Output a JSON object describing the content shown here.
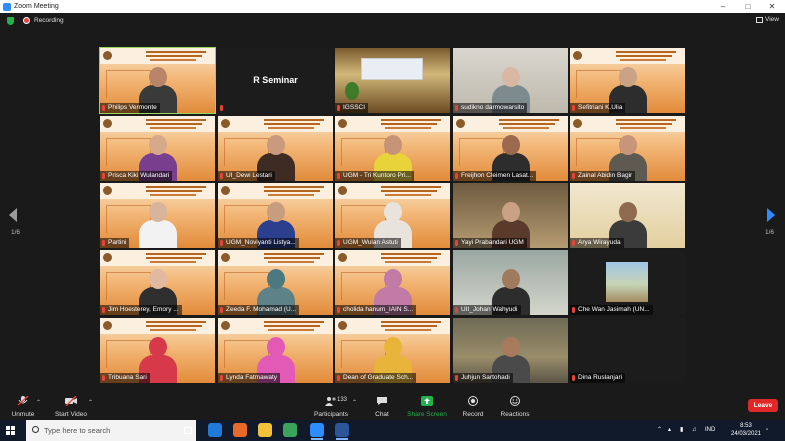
{
  "window": {
    "title": "Zoom Meeting"
  },
  "top": {
    "recording": "Recording",
    "view": "View"
  },
  "nav": {
    "left_page": "1/6",
    "right_page": "1/6"
  },
  "tiles": [
    {
      "name": "Philips Vermonte",
      "style": "banner",
      "speaking": true,
      "skin": "#b9856a",
      "shirt": "#3a3a3a"
    },
    {
      "name": "",
      "style": "black",
      "center_text": "R Seminar"
    },
    {
      "name": "IGSSCI",
      "style": "room"
    },
    {
      "name": "sudikno darmowarsito",
      "style": "home1",
      "skin": "#d8b8a2",
      "shirt": "#7d8a8e"
    },
    {
      "name": "Sefitriani K.Ulia",
      "style": "banner",
      "skin": "#caa285",
      "shirt": "#2d2d2d"
    },
    {
      "name": "Prisca Kiki Wulandari",
      "style": "banner",
      "skin": "#d6a98a",
      "shirt": "#7a3e8e"
    },
    {
      "name": "UI_Dewi Lestari",
      "style": "banner",
      "skin": "#c99a7d",
      "shirt": "#3d2b24"
    },
    {
      "name": "UGM - Tri Kuntoro Pri...",
      "style": "banner",
      "skin": "#c69376",
      "shirt": "#e9d33a"
    },
    {
      "name": "Freijhon Cleimen Lasat...",
      "style": "banner",
      "skin": "#9b6a4e",
      "shirt": "#2d2d2d"
    },
    {
      "name": "Zainal Abidin Bagir",
      "style": "banner",
      "skin": "#c7957a",
      "shirt": "#5e5a52"
    },
    {
      "name": "Partini",
      "style": "banner",
      "skin": "#d6b59c",
      "shirt": "#f2f2f2"
    },
    {
      "name": "UGM_Noviyanti Listya...",
      "style": "banner",
      "skin": "#c89c7f",
      "shirt": "#2c3f8f"
    },
    {
      "name": "UGM_Wulan Astuti",
      "style": "banner",
      "skin": "#e8e3dc",
      "shirt": "#e8e3dc"
    },
    {
      "name": "Yayi Prabandari UGM",
      "style": "home3",
      "skin": "#caa185",
      "shirt": "#5a3a2a"
    },
    {
      "name": "Arya Wirayuda",
      "style": "home2",
      "skin": "#8e6a4f",
      "shirt": "#3b3b3b"
    },
    {
      "name": "Jim Hoesterey, Emory ...",
      "style": "banner",
      "skin": "#e0b9a0",
      "shirt": "#2f2f2f"
    },
    {
      "name": "Zeeda F. Mohamad (U...",
      "style": "banner",
      "skin": "#4a7a80",
      "shirt": "#5f8288"
    },
    {
      "name": "cholida hanum_IAIN S...",
      "style": "banner",
      "skin": "#c27aa6",
      "shirt": "#c27aa6"
    },
    {
      "name": "UII_Johan Wahyudi",
      "style": "home4",
      "skin": "#a07a5c",
      "shirt": "#2d2d2d"
    },
    {
      "name": "Che Wan Jasimah (UN...",
      "style": "black",
      "smallpic": true
    },
    {
      "name": "Tribuana Sari",
      "style": "banner",
      "skin": "#d63a4a",
      "shirt": "#d63a4a"
    },
    {
      "name": "Lynda Fatmawaty",
      "style": "banner",
      "skin": "#e25ab6",
      "shirt": "#e25ab6"
    },
    {
      "name": "Dean of Graduate Sch...",
      "style": "banner",
      "skin": "#e8b53a",
      "shirt": "#e8b53a"
    },
    {
      "name": "Juhjun Sartohadi",
      "style": "forest",
      "skin": "#a77a5c",
      "shirt": "#4a4a4a"
    },
    {
      "name": "Dina Ruslanjari",
      "style": "black"
    }
  ],
  "toolbar": {
    "unmute": "Unmute",
    "start_video": "Start Video",
    "participants": "Participants",
    "participants_count": "133",
    "chat": "Chat",
    "share_screen": "Share Screen",
    "record": "Record",
    "reactions": "Reactions",
    "leave": "Leave"
  },
  "taskbar": {
    "search_placeholder": "Type here to search",
    "lang": "IND",
    "time": "8:53",
    "date": "24/03/2021"
  },
  "colors": {
    "accent": "#2d8cff",
    "leave": "#e02828",
    "share": "#23b14d",
    "speaking": "#9bd35a"
  }
}
